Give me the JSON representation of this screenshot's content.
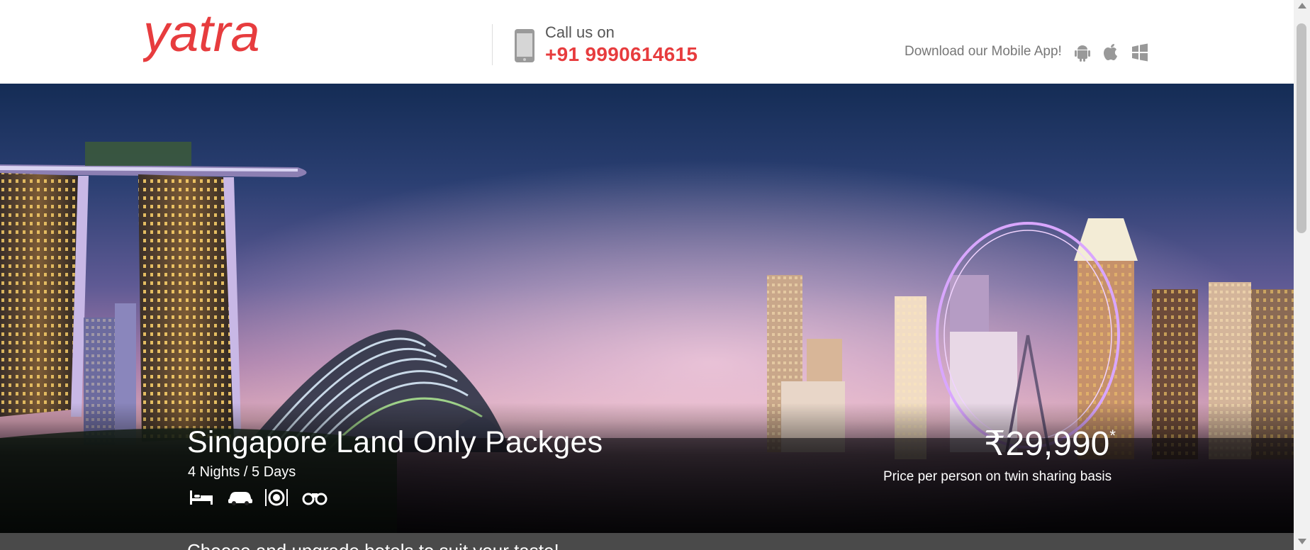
{
  "brand": {
    "name": "yatra",
    "color": "#e73c3e"
  },
  "header": {
    "call_label": "Call us on",
    "call_number": "+91 9990614615",
    "app_label": "Download our Mobile App!",
    "app_icons": [
      "android-icon",
      "apple-icon",
      "windows-icon"
    ]
  },
  "hero": {
    "title": "Singapore Land Only Packges",
    "duration": "4 Nights / 5 Days",
    "amenities": [
      "hotel-icon",
      "car-icon",
      "meal-icon",
      "sightseeing-icon"
    ],
    "price": "₹29,990",
    "price_mark": "*",
    "price_note": "Price per person on twin sharing basis"
  },
  "bottom_bar": {
    "text": "Choose and upgrade hotels to suit your taste!"
  }
}
